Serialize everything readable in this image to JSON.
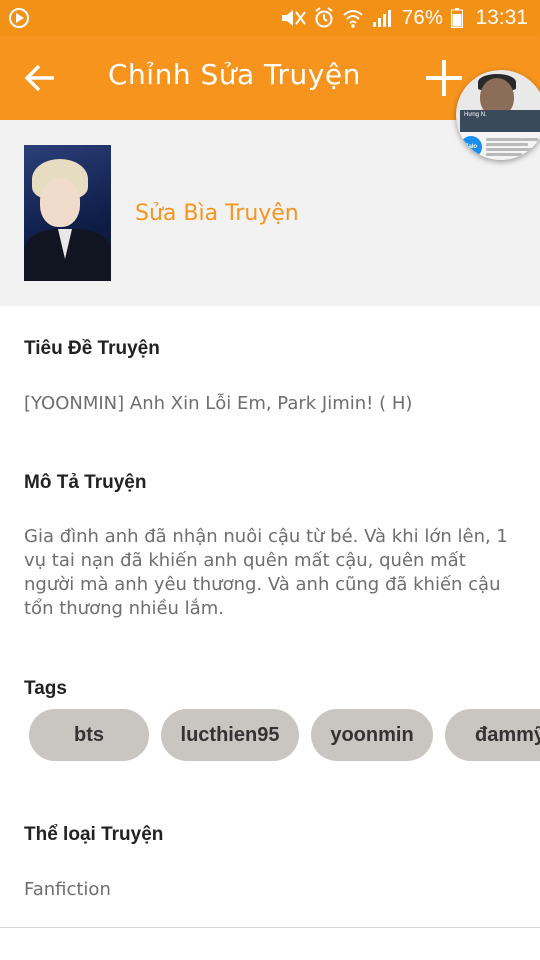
{
  "status_bar": {
    "battery_percent": "76%",
    "time": "13:31",
    "icons": [
      "media-play-icon",
      "mute-icon",
      "alarm-icon",
      "wifi-icon",
      "signal-icon",
      "battery-icon"
    ]
  },
  "app_bar": {
    "title": "Chỉnh Sửa Truyện",
    "back_icon": "back-arrow-icon",
    "add_icon": "plus-icon"
  },
  "chat_head": {
    "name": "Hưng N.",
    "app_badge": "Zalo"
  },
  "cover": {
    "edit_label": "Sửa Bìa Truyện"
  },
  "story": {
    "title_label": "Tiêu Đề Truyện",
    "title_value": "[YOONMIN] Anh Xin Lỗi Em, Park Jimin! ( H)",
    "description_label": "Mô Tả Truyện",
    "description_value": "Gia đình anh đã nhận nuôi cậu từ bé. Và khi lớn lên, 1 vụ tai nạn đã khiến anh quên mất cậu, quên mất người mà anh yêu thương. Và anh cũng đã khiến cậu tổn thương nhiều lắm.",
    "tags_label": "Tags",
    "tags": [
      "bts",
      "lucthien95",
      "yoonmin",
      "đammỹ"
    ],
    "category_label": "Thể loại Truyện",
    "category_value": "Fanfiction"
  },
  "colors": {
    "status_bar": "#f39016",
    "app_bar": "#f7941d",
    "accent": "#f7941d",
    "tag_bg": "#c9c5c1"
  }
}
